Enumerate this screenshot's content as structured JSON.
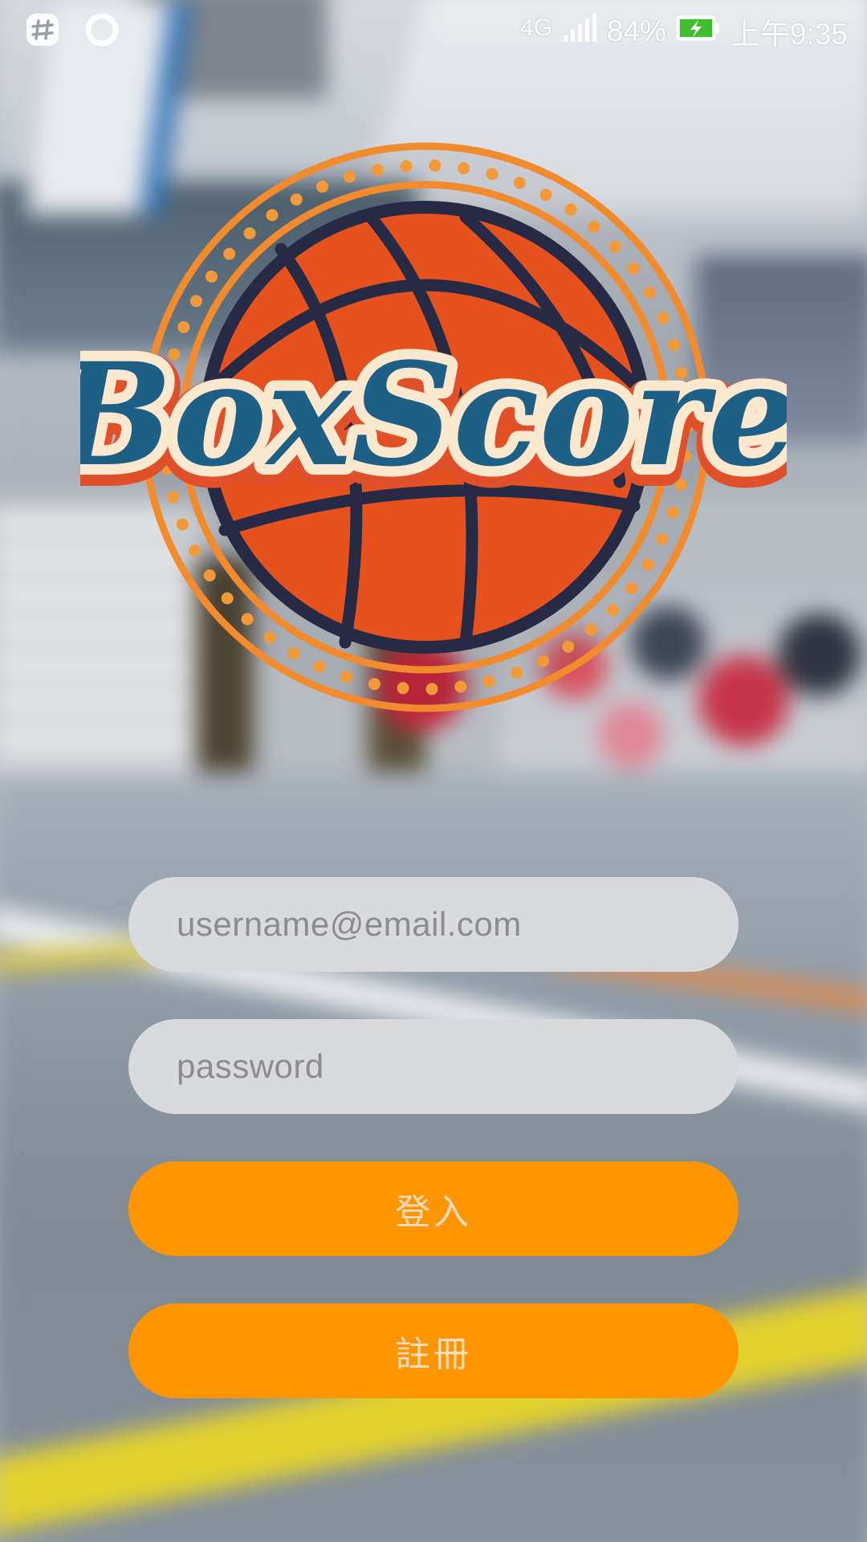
{
  "status_bar": {
    "left_icons": [
      "slack-icon",
      "circle-notification-icon"
    ],
    "network_type": "4G",
    "signal_icon": "signal-bars-icon",
    "battery_percent": "84%",
    "battery_icon": "battery-charging-icon",
    "time": "上午9:35"
  },
  "logo": {
    "text": "BoxScore",
    "icon": "basketball-icon"
  },
  "login_form": {
    "username_placeholder": "username@email.com",
    "password_placeholder": "password",
    "login_label": "登入",
    "register_label": "註冊"
  },
  "colors": {
    "button": "#ff9500",
    "field": "#d9dade",
    "logo_ring": "#f28a2e",
    "ball": "#e5521e",
    "logo_text": "#1e5f86"
  }
}
